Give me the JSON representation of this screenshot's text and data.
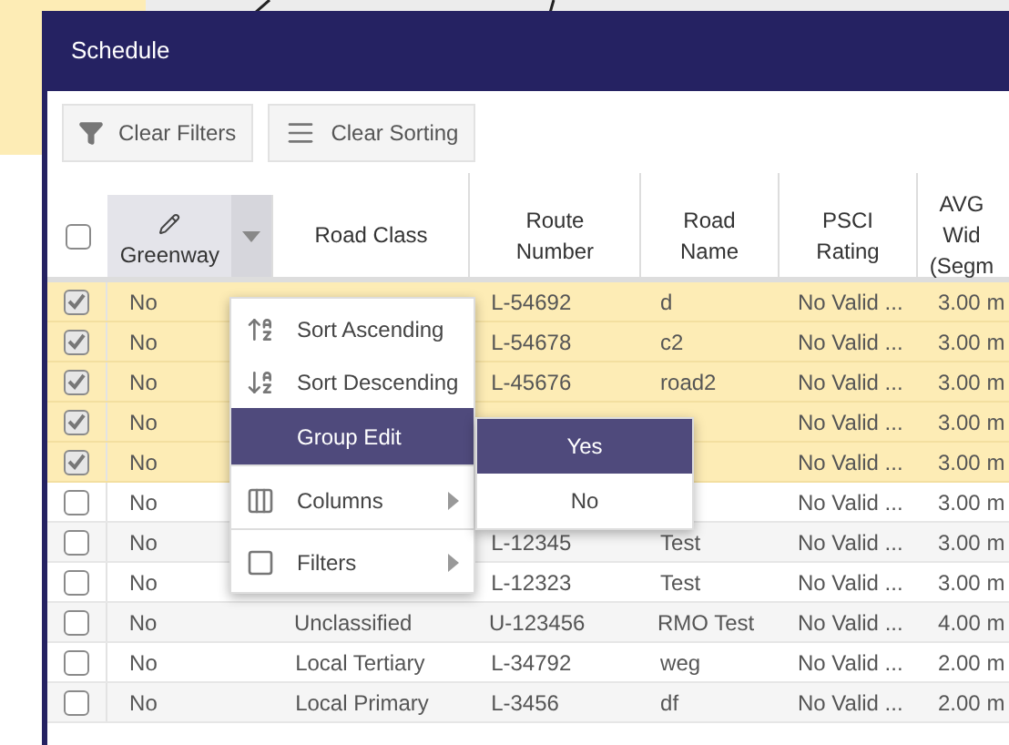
{
  "window": {
    "title": "Schedule"
  },
  "toolbar": [
    {
      "label": "Clear Filters"
    },
    {
      "label": "Clear Sorting"
    }
  ],
  "table": {
    "select_all": {
      "checked": false
    },
    "columns": [
      {
        "label": "Greenway",
        "menu_open": true
      },
      {
        "label": "Road Class"
      },
      {
        "label": "Route Number"
      },
      {
        "label": "Road Name"
      },
      {
        "label": "PSCI Rating"
      },
      {
        "label": "AVG Wid (Segm"
      }
    ],
    "rows": [
      {
        "checked": true,
        "cells": [
          "No",
          null,
          "L-54692",
          "d",
          "No Valid ...",
          "3.00 m"
        ]
      },
      {
        "checked": true,
        "cells": [
          "No",
          null,
          "L-54678",
          "c2",
          "No Valid ...",
          "3.00 m"
        ]
      },
      {
        "checked": true,
        "cells": [
          "No",
          null,
          "L-45676",
          "road2",
          "No Valid ...",
          "3.00 m"
        ]
      },
      {
        "checked": true,
        "cells": [
          "No",
          null,
          null,
          null,
          "No Valid ...",
          "3.00 m"
        ]
      },
      {
        "checked": true,
        "cells": [
          "No",
          null,
          null,
          null,
          "No Valid ...",
          "3.00 m"
        ]
      },
      {
        "checked": false,
        "cells": [
          "No",
          null,
          null,
          null,
          "No Valid ...",
          "3.00 m"
        ]
      },
      {
        "checked": false,
        "cells": [
          "No",
          null,
          "L-12345",
          "Test",
          "No Valid ...",
          "3.00 m"
        ]
      },
      {
        "checked": false,
        "cells": [
          "No",
          null,
          "L-12323",
          "Test",
          "No Valid ...",
          "3.00 m"
        ]
      },
      {
        "checked": false,
        "cells": [
          "No",
          "Unclassified",
          "U-123456",
          "RMO Test",
          "No Valid ...",
          "4.00 m"
        ]
      },
      {
        "checked": false,
        "cells": [
          "No",
          "Local Tertiary",
          "L-34792",
          "weg",
          "No Valid ...",
          "2.00 m"
        ]
      },
      {
        "checked": false,
        "cells": [
          "No",
          "Local Primary",
          "L-3456",
          "df",
          "No Valid ...",
          "2.00 m"
        ]
      }
    ]
  },
  "context_menu": {
    "items": [
      {
        "label": "Sort Ascending",
        "kind": "sort-asc",
        "submenu": false,
        "selected": false,
        "divider_after": false
      },
      {
        "label": "Sort Descending",
        "kind": "sort-desc",
        "submenu": false,
        "selected": false,
        "divider_after": false
      },
      {
        "label": "Group Edit",
        "kind": "plain",
        "submenu": false,
        "selected": true,
        "divider_after": true
      },
      {
        "label": "Columns",
        "kind": "columns",
        "submenu": true,
        "selected": false,
        "divider_after": true
      },
      {
        "label": "Filters",
        "kind": "filters",
        "submenu": true,
        "selected": false,
        "divider_after": false
      }
    ]
  },
  "submenu": {
    "items": [
      {
        "label": "Yes",
        "selected": true
      },
      {
        "label": "No",
        "selected": false
      }
    ]
  }
}
